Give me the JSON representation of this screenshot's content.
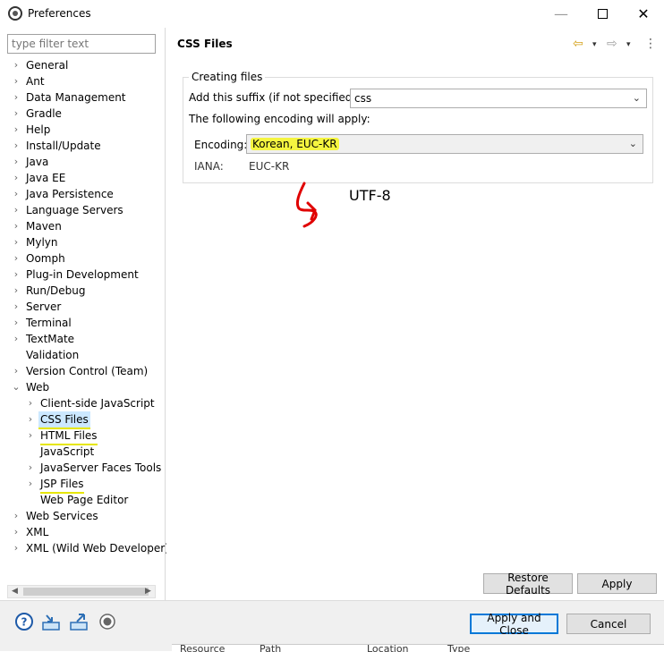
{
  "window": {
    "title": "Preferences",
    "min_glyph": "—",
    "close_glyph": "✕"
  },
  "filter": {
    "placeholder": "type filter text"
  },
  "tree": [
    {
      "label": "General",
      "expand": "›"
    },
    {
      "label": "Ant",
      "expand": "›"
    },
    {
      "label": "Data Management",
      "expand": "›"
    },
    {
      "label": "Gradle",
      "expand": "›"
    },
    {
      "label": "Help",
      "expand": "›"
    },
    {
      "label": "Install/Update",
      "expand": "›"
    },
    {
      "label": "Java",
      "expand": "›"
    },
    {
      "label": "Java EE",
      "expand": "›"
    },
    {
      "label": "Java Persistence",
      "expand": "›"
    },
    {
      "label": "Language Servers",
      "expand": "›"
    },
    {
      "label": "Maven",
      "expand": "›"
    },
    {
      "label": "Mylyn",
      "expand": "›"
    },
    {
      "label": "Oomph",
      "expand": "›"
    },
    {
      "label": "Plug-in Development",
      "expand": "›"
    },
    {
      "label": "Run/Debug",
      "expand": "›"
    },
    {
      "label": "Server",
      "expand": "›"
    },
    {
      "label": "Terminal",
      "expand": "›"
    },
    {
      "label": "TextMate",
      "expand": "›"
    },
    {
      "label": "Validation",
      "expand": ""
    },
    {
      "label": "Version Control (Team)",
      "expand": "›"
    },
    {
      "label": "Web",
      "expand": "⌄"
    },
    {
      "label": "Client-side JavaScript",
      "expand": "›"
    },
    {
      "label": "CSS Files",
      "expand": "›"
    },
    {
      "label": "HTML Files",
      "expand": "›"
    },
    {
      "label": "JavaScript",
      "expand": ""
    },
    {
      "label": "JavaServer Faces Tools",
      "expand": "›"
    },
    {
      "label": "JSP Files",
      "expand": "›"
    },
    {
      "label": "Web Page Editor",
      "expand": ""
    },
    {
      "label": "Web Services",
      "expand": "›"
    },
    {
      "label": "XML",
      "expand": "›"
    },
    {
      "label": "XML (Wild Web Developer)",
      "expand": "›"
    }
  ],
  "page": {
    "title": "CSS Files",
    "nav_back_glyph": "⇦",
    "nav_forward_glyph": "⇨",
    "nav_dropdown_glyph": "▾",
    "nav_menu_glyph": "⋮",
    "group_title": "Creating files",
    "suffix_label": "Add this suffix (if not specified):",
    "suffix_value": "css",
    "encoding_note": "The following encoding will apply:",
    "encoding_label": "Encoding:",
    "encoding_value": "Korean, EUC-KR",
    "iana_label": "IANA:",
    "iana_value": "EUC-KR",
    "annotation_text": "UTF-8"
  },
  "buttons": {
    "restore_defaults": "Restore Defaults",
    "apply": "Apply",
    "apply_and_close": "Apply and Close",
    "cancel": "Cancel"
  },
  "peek": {
    "col1": "Resource",
    "col2": "Path",
    "col3": "Location",
    "col4": "Type"
  },
  "colors": {
    "highlight": "#f5f540",
    "selection": "#cce8ff",
    "annotation": "#e00000",
    "default_button_border": "#0078d7"
  }
}
